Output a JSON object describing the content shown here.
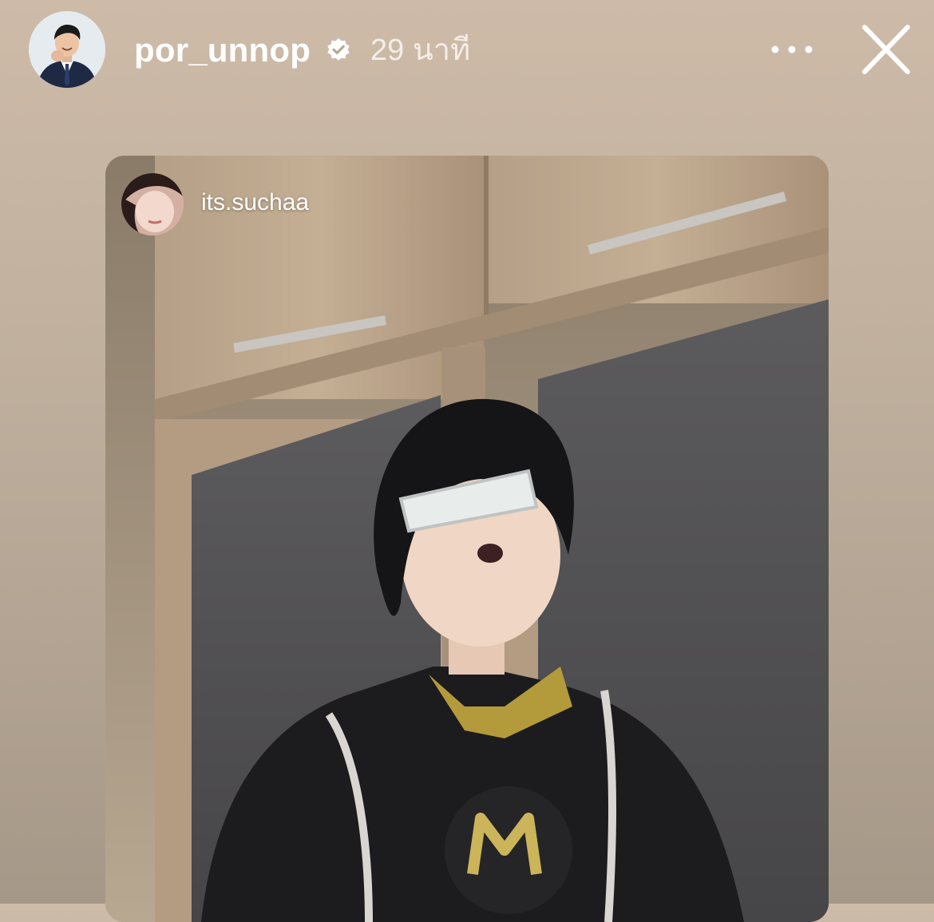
{
  "header": {
    "username": "por_unnop",
    "verified": true,
    "time_ago": "29 นาที",
    "icons": {
      "verified": "verified-badge-icon",
      "more": "more-dots-icon",
      "close": "close-icon"
    }
  },
  "reshared_story": {
    "username": "its.suchaa"
  },
  "colors": {
    "background_top": "#cdbba8",
    "background_bottom": "#a69888",
    "text": "#ffffff"
  }
}
